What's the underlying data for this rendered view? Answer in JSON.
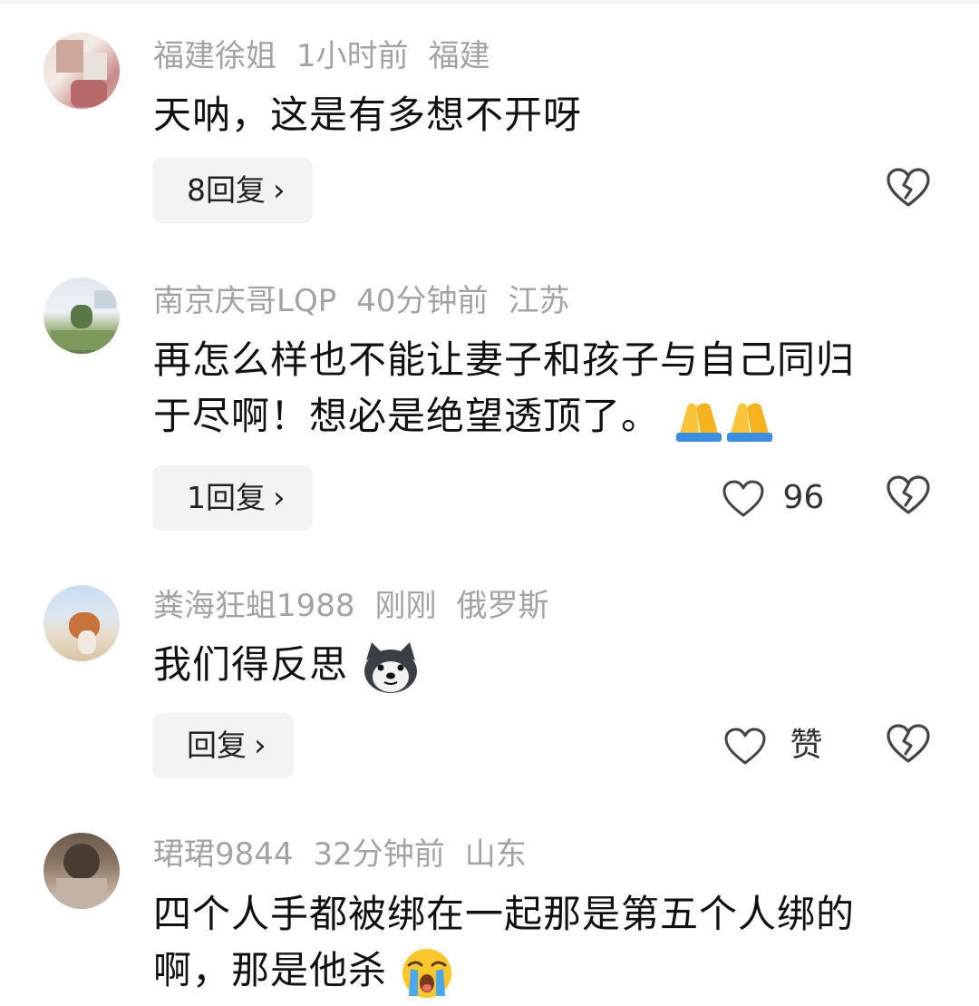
{
  "comments": [
    {
      "user": "福建徐姐",
      "time": "1小时前",
      "location": "福建",
      "text": "天呐，这是有多想不开呀",
      "reply_label": "8回复",
      "icons": {
        "like": "heart-icon",
        "dislike": "broken-heart-icon"
      }
    },
    {
      "user": "南京庆哥LQP",
      "time": "40分钟前",
      "location": "江苏",
      "text_line1": "再怎么样也不能让妻子和孩子与自己同归",
      "text_line2": "于尽啊！想必是绝望透顶了。",
      "reply_label": "1回复",
      "like_count": "96",
      "emoji": "folded-hands-emoji"
    },
    {
      "user": "粪海狂蛆1988",
      "time": "刚刚",
      "location": "俄罗斯",
      "text": "我们得反思",
      "reply_label": "回复",
      "like_label": "赞",
      "emoji": "husky-dog-emoji"
    },
    {
      "user": "珺珺9844",
      "time": "32分钟前",
      "location": "山东",
      "text_line1": "四个人手都被绑在一起那是第五个人绑的",
      "text_line2": "啊，那是他杀",
      "emoji": "crying-face-emoji"
    }
  ],
  "colors": {
    "meta": "#a3a3a3",
    "text": "#111111",
    "reply_bg": "#f3f3f5"
  }
}
